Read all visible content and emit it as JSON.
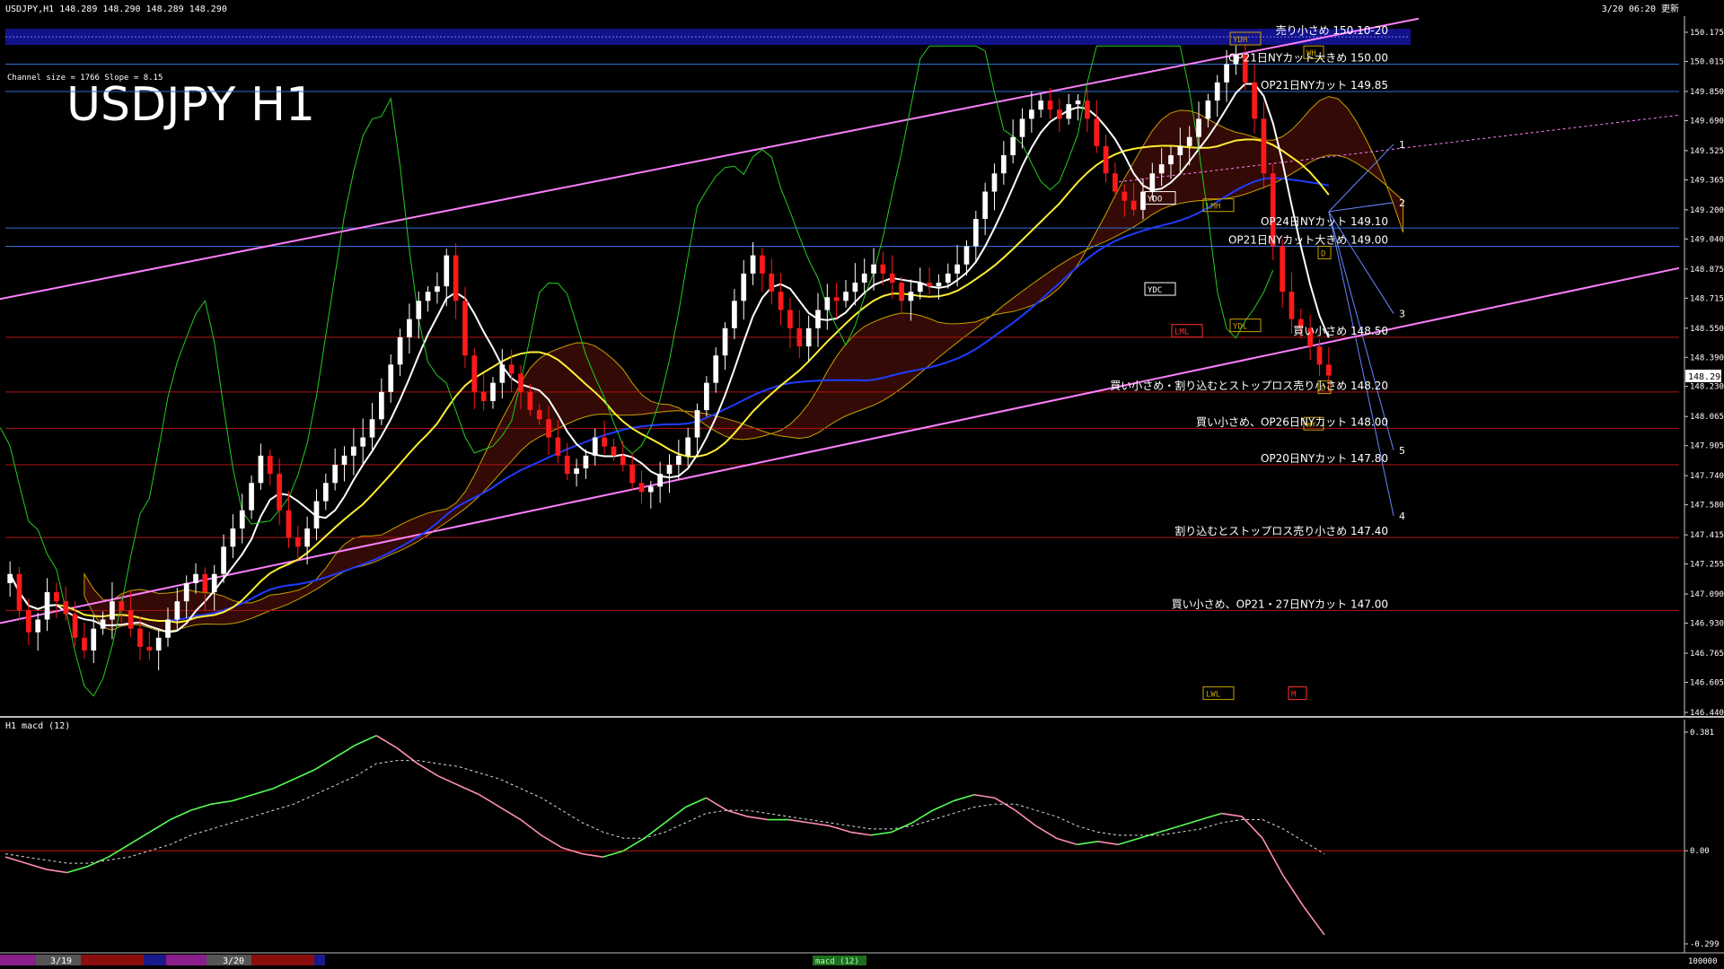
{
  "header": {
    "symbol_info": "USDJPY,H1  148.289 148.290 148.289 148.290",
    "timestamp": "3/20 06:20 更新",
    "channel_info": "Channel size = 1766 Slope = 8.15",
    "big_title": "USDJPY H1"
  },
  "chart_data": {
    "type": "candlestick",
    "symbol": "USDJPY",
    "timeframe": "H1",
    "ylim": [
      146.44,
      150.175
    ],
    "y_ticks": [
      "150.175",
      "150.015",
      "149.850",
      "149.690",
      "149.525",
      "149.365",
      "149.200",
      "149.040",
      "148.875",
      "148.715",
      "148.550",
      "148.390",
      "148.230",
      "148.065",
      "147.905",
      "147.740",
      "147.580",
      "147.415",
      "147.255",
      "147.090",
      "146.930",
      "146.765",
      "146.605",
      "146.440"
    ],
    "current_price": "148.290",
    "channel": {
      "upper": [
        [
          0,
          148.71
        ],
        [
          1580,
          150.25
        ]
      ],
      "lower": [
        [
          0,
          146.93
        ],
        [
          1870,
          148.88
        ]
      ]
    },
    "levels": [
      {
        "label": "売り小さめ 150.10-20",
        "price": 150.15,
        "color": "#1a1aff"
      },
      {
        "label": "OP21日NYカット大きめ 150.00",
        "price": 150.0,
        "color": "#2f6fd6"
      },
      {
        "label": "OP21日NYカット 149.85",
        "price": 149.85,
        "color": "#2f6fd6"
      },
      {
        "label": "OP24日NYカット 149.10",
        "price": 149.1,
        "color": "#2f6fd6"
      },
      {
        "label": "OP21日NYカット大きめ 149.00",
        "price": 149.0,
        "color": "#2f6fd6"
      },
      {
        "label": "買い小さめ 148.50",
        "price": 148.5,
        "color": "#b01515"
      },
      {
        "label": "買い小さめ・割り込むとストップロス売り小さめ 148.20",
        "price": 148.2,
        "color": "#b01515"
      },
      {
        "label": "買い小さめ、OP26日NYカット 148.00",
        "price": 148.0,
        "color": "#b01515"
      },
      {
        "label": "OP20日NYカット 147.80",
        "price": 147.8,
        "color": "#b01515"
      },
      {
        "label": "割り込むとストップロス売り小さめ 147.40",
        "price": 147.4,
        "color": "#b01515"
      },
      {
        "label": "買い小さめ、OP21・27日NYカット 147.00",
        "price": 147.0,
        "color": "#b01515"
      }
    ],
    "projection_labels": [
      {
        "label": "1",
        "price": 149.56
      },
      {
        "label": "2",
        "price": 149.24
      },
      {
        "label": "3",
        "price": 148.63
      },
      {
        "label": "5",
        "price": 147.88
      },
      {
        "label": "4",
        "price": 147.52
      }
    ],
    "box_labels": [
      "YDH",
      "YDO",
      "YDC",
      "YDL",
      "LML",
      "LMH",
      "LWL",
      "M",
      "WH",
      "WY",
      "D",
      "D"
    ],
    "closes": [
      147.2,
      147.0,
      146.88,
      146.95,
      147.1,
      147.05,
      146.98,
      146.85,
      146.78,
      146.9,
      146.95,
      147.05,
      147.0,
      146.9,
      146.8,
      146.78,
      146.85,
      146.95,
      147.05,
      147.15,
      147.2,
      147.1,
      147.2,
      147.35,
      147.45,
      147.55,
      147.7,
      147.85,
      147.75,
      147.55,
      147.4,
      147.35,
      147.45,
      147.6,
      147.7,
      147.8,
      147.85,
      147.9,
      147.95,
      148.05,
      148.2,
      148.35,
      148.5,
      148.6,
      148.7,
      148.75,
      148.78,
      148.95,
      148.7,
      148.4,
      148.2,
      148.15,
      148.25,
      148.35,
      148.3,
      148.2,
      148.1,
      148.05,
      147.95,
      147.85,
      147.75,
      147.78,
      147.85,
      147.95,
      147.9,
      147.85,
      147.8,
      147.7,
      147.65,
      147.68,
      147.75,
      147.8,
      147.85,
      147.95,
      148.1,
      148.25,
      148.4,
      148.55,
      148.7,
      148.85,
      148.95,
      148.85,
      148.75,
      148.65,
      148.55,
      148.45,
      148.55,
      148.65,
      148.72,
      148.7,
      148.75,
      148.8,
      148.85,
      148.9,
      148.85,
      148.8,
      148.7,
      148.75,
      148.8,
      148.78,
      148.8,
      148.85,
      148.9,
      149.0,
      149.15,
      149.3,
      149.4,
      149.5,
      149.6,
      149.7,
      149.75,
      149.8,
      149.75,
      149.7,
      149.78,
      149.8,
      149.7,
      149.55,
      149.4,
      149.3,
      149.25,
      149.2,
      149.3,
      149.4,
      149.45,
      149.5,
      149.55,
      149.6,
      149.7,
      149.8,
      149.9,
      150.0,
      150.05,
      149.9,
      149.7,
      149.4,
      149.0,
      148.75,
      148.6,
      148.55,
      148.45,
      148.35,
      148.29
    ],
    "macd": {
      "name": "macd (12)",
      "panel_label": "H1  macd (12)",
      "ylim": [
        -0.299,
        0.381
      ],
      "y_ticks": [
        "0.381",
        "0.00",
        "-0.299"
      ],
      "macd": [
        -0.02,
        -0.04,
        -0.06,
        -0.07,
        -0.05,
        -0.02,
        0.02,
        0.06,
        0.1,
        0.13,
        0.15,
        0.16,
        0.18,
        0.2,
        0.23,
        0.26,
        0.3,
        0.34,
        0.37,
        0.33,
        0.28,
        0.24,
        0.21,
        0.18,
        0.14,
        0.1,
        0.05,
        0.01,
        -0.01,
        -0.02,
        0.0,
        0.04,
        0.09,
        0.14,
        0.17,
        0.13,
        0.11,
        0.1,
        0.1,
        0.09,
        0.08,
        0.06,
        0.05,
        0.06,
        0.09,
        0.13,
        0.16,
        0.18,
        0.17,
        0.13,
        0.08,
        0.04,
        0.02,
        0.03,
        0.02,
        0.04,
        0.06,
        0.08,
        0.1,
        0.12,
        0.11,
        0.04,
        -0.08,
        -0.18,
        -0.27
      ],
      "signal": [
        -0.01,
        -0.02,
        -0.03,
        -0.04,
        -0.04,
        -0.03,
        -0.02,
        0.0,
        0.02,
        0.05,
        0.07,
        0.09,
        0.11,
        0.13,
        0.15,
        0.18,
        0.21,
        0.24,
        0.28,
        0.29,
        0.29,
        0.28,
        0.27,
        0.25,
        0.23,
        0.2,
        0.17,
        0.13,
        0.09,
        0.06,
        0.04,
        0.04,
        0.06,
        0.09,
        0.12,
        0.13,
        0.13,
        0.12,
        0.11,
        0.1,
        0.09,
        0.08,
        0.07,
        0.07,
        0.08,
        0.1,
        0.12,
        0.14,
        0.15,
        0.15,
        0.13,
        0.11,
        0.08,
        0.06,
        0.05,
        0.05,
        0.05,
        0.06,
        0.07,
        0.09,
        0.1,
        0.1,
        0.07,
        0.03,
        -0.01
      ]
    },
    "date_labels": [
      "3/19",
      "3/20"
    ],
    "bottom_tag": "macd (12)",
    "corner_value": "100000"
  },
  "colors": {
    "background": "#000000",
    "up_candle": "#ffffff",
    "down_candle": "#ff1a1a",
    "channel": "#ff7fff",
    "ma_white": "#ffffff",
    "ma_yellow": "#ffee33",
    "ma_blue": "#1e3cff",
    "chikou": "#22cc22",
    "cloud": "#a02010",
    "macd_up": "#55ff55",
    "macd_down": "#ff8fb0"
  }
}
